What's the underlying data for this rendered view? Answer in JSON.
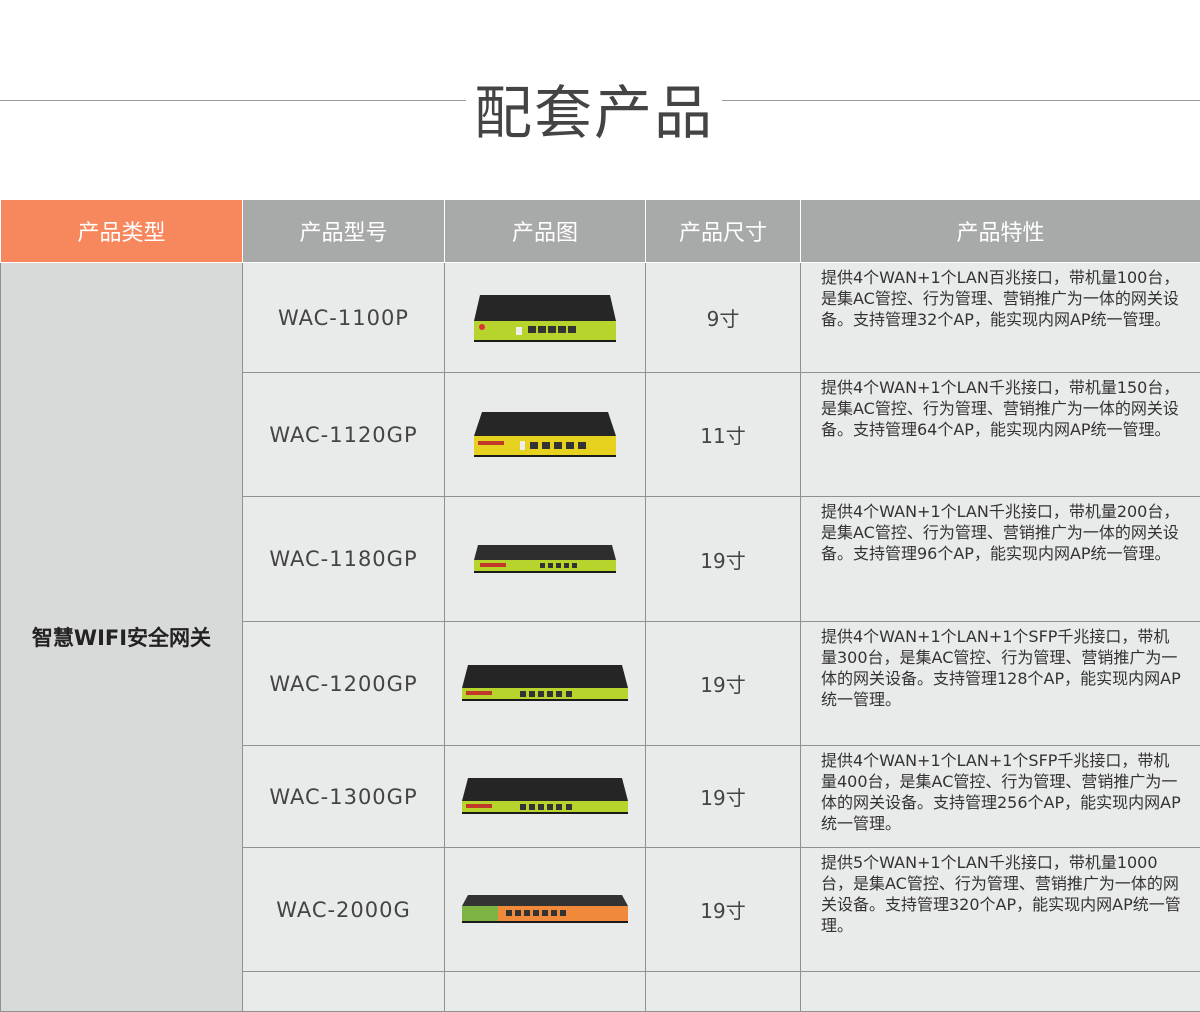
{
  "page": {
    "title": "配套产品"
  },
  "table": {
    "headers": [
      "产品类型",
      "产品型号",
      "产品图",
      "产品尺寸",
      "产品特性"
    ],
    "category": "智慧WIFI安全网关",
    "rows": [
      {
        "model": "WAC-1100P",
        "size": "9寸",
        "desc": "提供4个WAN+1个LAN百兆接口，带机量100台，是集AC管控、行为管理、营销推广为一体的网关设备。支持管理32个AP，能实现内网AP统一管理。"
      },
      {
        "model": "WAC-1120GP",
        "size": "11寸",
        "desc": "提供4个WAN+1个LAN千兆接口，带机量150台，是集AC管控、行为管理、营销推广为一体的网关设备。支持管理64个AP，能实现内网AP统一管理。"
      },
      {
        "model": "WAC-1180GP",
        "size": "19寸",
        "desc": "提供4个WAN+1个LAN千兆接口，带机量200台，是集AC管控、行为管理、营销推广为一体的网关设备。支持管理96个AP，能实现内网AP统一管理。"
      },
      {
        "model": "WAC-1200GP",
        "size": "19寸",
        "desc": "提供4个WAN+1个LAN+1个SFP千兆接口，带机量300台，是集AC管控、行为管理、营销推广为一体的网关设备。支持管理128个AP，能实现内网AP统一管理。"
      },
      {
        "model": "WAC-1300GP",
        "size": "19寸",
        "desc": "提供4个WAN+1个LAN+1个SFP千兆接口，带机量400台，是集AC管控、行为管理、营销推广为一体的网关设备。支持管理256个AP，能实现内网AP统一管理。"
      },
      {
        "model": "WAC-2000G",
        "size": "19寸",
        "desc": "提供5个WAN+1个LAN千兆接口，带机量1000台，是集AC管控、行为管理、营销推广为一体的网关设备。支持管理320个AP，能实现内网AP统一管理。"
      }
    ]
  },
  "images": {
    "device_brand": "secnetcom",
    "colors": {
      "header_accent": "#f7875c",
      "header_gray": "#a8aaaa",
      "device_front_green": "#b7d42d",
      "device_front_orange": "#f08a3a",
      "device_body": "#2a2a2a"
    }
  }
}
